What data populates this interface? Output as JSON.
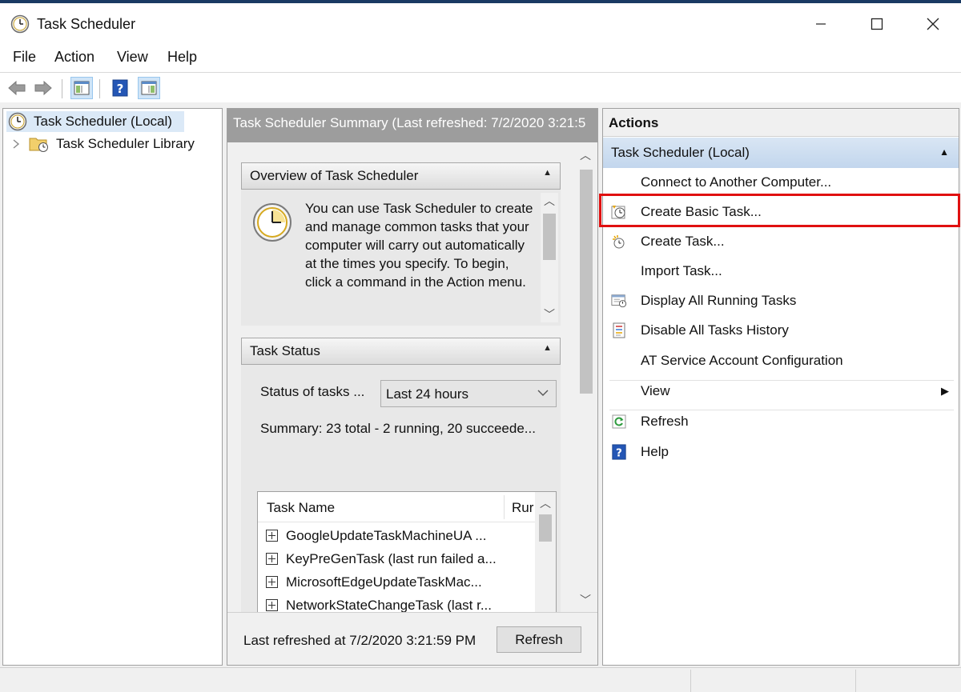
{
  "window": {
    "title": "Task Scheduler"
  },
  "menu": [
    "File",
    "Action",
    "View",
    "Help"
  ],
  "tree": {
    "root": "Task Scheduler (Local)",
    "child": "Task Scheduler Library"
  },
  "center": {
    "header": "Task Scheduler Summary (Last refreshed: 7/2/2020 3:21:5",
    "overview": {
      "title": "Overview of Task Scheduler",
      "text": "You can use Task Scheduler to create and manage common tasks that your computer will carry out automatically at the times you specify. To begin, click a command in the Action menu."
    },
    "status": {
      "title": "Task Status",
      "filter_label": "Status of tasks ...",
      "filter_value": "Last 24 hours",
      "summary": "Summary: 23 total - 2 running, 20 succeede..."
    },
    "grid": {
      "columns": [
        "Task Name",
        "Rur"
      ],
      "rows": [
        "GoogleUpdateTaskMachineUA ...",
        "KeyPreGenTask (last run failed a...",
        "MicrosoftEdgeUpdateTaskMac...",
        "NetworkStateChangeTask (last r..."
      ]
    },
    "footer": {
      "last_refreshed": "Last refreshed at 7/2/2020 3:21:59 PM",
      "refresh_label": "Refresh"
    }
  },
  "actions": {
    "title": "Actions",
    "group": "Task Scheduler (Local)",
    "items": [
      {
        "label": "Connect to Another Computer...",
        "icon": "none"
      },
      {
        "label": "Create Basic Task...",
        "icon": "clock-wizard-icon"
      },
      {
        "label": "Create Task...",
        "icon": "new-task-icon"
      },
      {
        "label": "Import Task...",
        "icon": "none"
      },
      {
        "label": "Display All Running Tasks",
        "icon": "running-tasks-icon"
      },
      {
        "label": "Disable All Tasks History",
        "icon": "history-icon"
      },
      {
        "label": "AT Service Account Configuration",
        "icon": "none"
      },
      {
        "label": "View",
        "icon": "none"
      },
      {
        "label": "Refresh",
        "icon": "refresh-icon"
      },
      {
        "label": "Help",
        "icon": "help-icon"
      }
    ]
  },
  "colors": {
    "accent_highlight": "#e01010",
    "selection": "#dbe9f7",
    "group_header": "#c2d6ed"
  }
}
